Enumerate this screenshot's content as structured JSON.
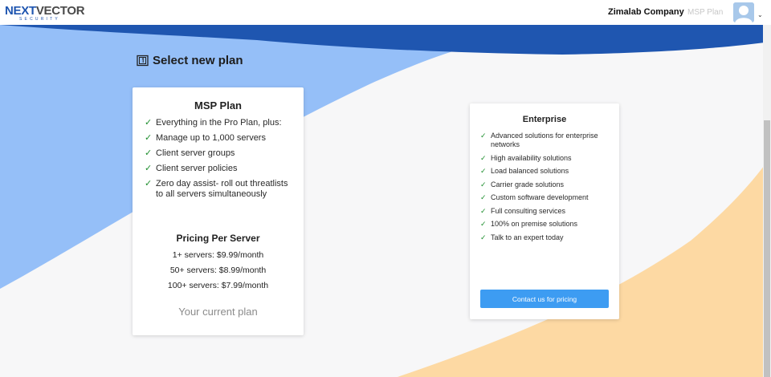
{
  "header": {
    "logo_text_a": "NEXT",
    "logo_text_b": "VECTOR",
    "logo_subtext": "SECURITY",
    "company": "Zimalab Company",
    "plan_link": "MSP Plan",
    "avatar_icon": "user-avatar-icon",
    "menu_icon": "chevron-down-icon"
  },
  "page": {
    "title": "Select new plan",
    "title_icon": "plan-book-icon"
  },
  "plans": [
    {
      "name": "MSP Plan",
      "features": [
        "Everything in the Pro Plan, plus:",
        "Manage up to 1,000 servers",
        "Client server groups",
        "Client server policies",
        "Zero day assist- roll out threatlists to all servers simultaneously"
      ],
      "pricing_title": "Pricing Per Server",
      "prices": [
        "1+ servers: $9.99/month",
        "50+ servers: $8.99/month",
        "100+ servers: $7.99/month"
      ],
      "status": "Your current plan"
    },
    {
      "name": "Enterprise",
      "features": [
        "Advanced solutions for enterprise networks",
        "High availability solutions",
        "Load balanced solutions",
        "Carrier grade solutions",
        "Custom software development",
        "Full consulting services",
        "100% on premise solutions",
        "Talk to an expert today"
      ],
      "cta": "Contact us for pricing"
    }
  ],
  "check_glyph": "✓",
  "colors": {
    "brand_blue": "#1f56b0",
    "light_blue": "#95bff8",
    "peach": "#fdd9a3",
    "button_blue": "#3d9cf2",
    "check_green": "#1e8e2e"
  }
}
